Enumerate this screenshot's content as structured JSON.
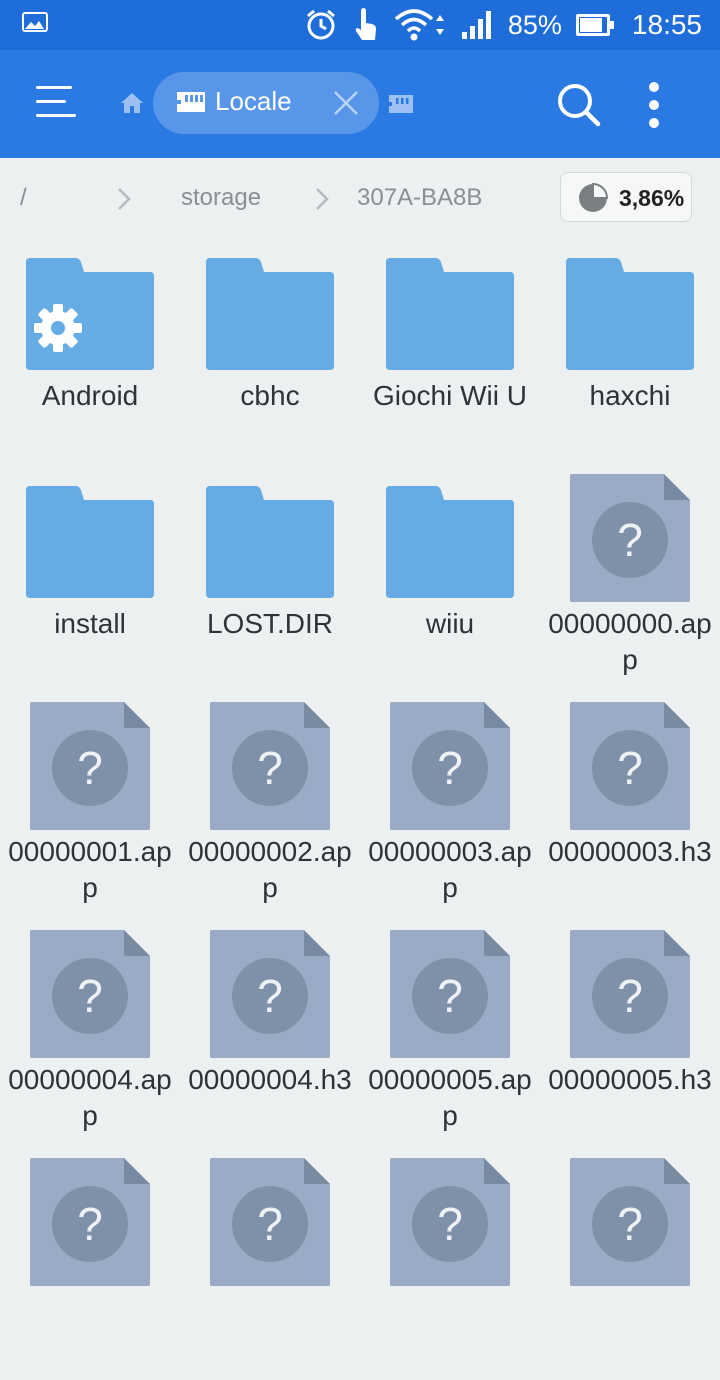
{
  "status_bar": {
    "battery": "85%",
    "battery_level": 0.85,
    "time": "18:55",
    "icons": [
      "gallery-icon",
      "alarm-icon",
      "touch-icon",
      "wifi-icon",
      "signal-icon",
      "battery-icon"
    ]
  },
  "toolbar": {
    "tab_label": "Locale",
    "icons": [
      "menu-icon",
      "home-icon",
      "sd-card-icon",
      "close-icon",
      "sd-card-icon",
      "search-icon",
      "more-icon"
    ]
  },
  "breadcrumb": {
    "items": [
      "/",
      "storage",
      "307A-BA8B"
    ],
    "usage": "3,86%"
  },
  "colors": {
    "status_bar": "#1f6dd8",
    "toolbar": "#2b7ae3",
    "folder": "#64ace3",
    "unknown_file": "#9aabc6",
    "background": "#edf0f0"
  },
  "items": [
    {
      "type": "folder-settings",
      "name": "Android"
    },
    {
      "type": "folder",
      "name": "cbhc"
    },
    {
      "type": "folder",
      "name": "Giochi Wii U"
    },
    {
      "type": "folder",
      "name": "haxchi"
    },
    {
      "type": "folder",
      "name": "install"
    },
    {
      "type": "folder",
      "name": "LOST.DIR"
    },
    {
      "type": "folder",
      "name": "wiiu"
    },
    {
      "type": "file",
      "name": "00000000.app"
    },
    {
      "type": "file",
      "name": "00000001.app"
    },
    {
      "type": "file",
      "name": "00000002.app"
    },
    {
      "type": "file",
      "name": "00000003.app"
    },
    {
      "type": "file",
      "name": "00000003.h3"
    },
    {
      "type": "file",
      "name": "00000004.app"
    },
    {
      "type": "file",
      "name": "00000004.h3"
    },
    {
      "type": "file",
      "name": "00000005.app"
    },
    {
      "type": "file",
      "name": "00000005.h3"
    },
    {
      "type": "file",
      "name": ""
    },
    {
      "type": "file",
      "name": ""
    },
    {
      "type": "file",
      "name": ""
    },
    {
      "type": "file",
      "name": ""
    }
  ]
}
